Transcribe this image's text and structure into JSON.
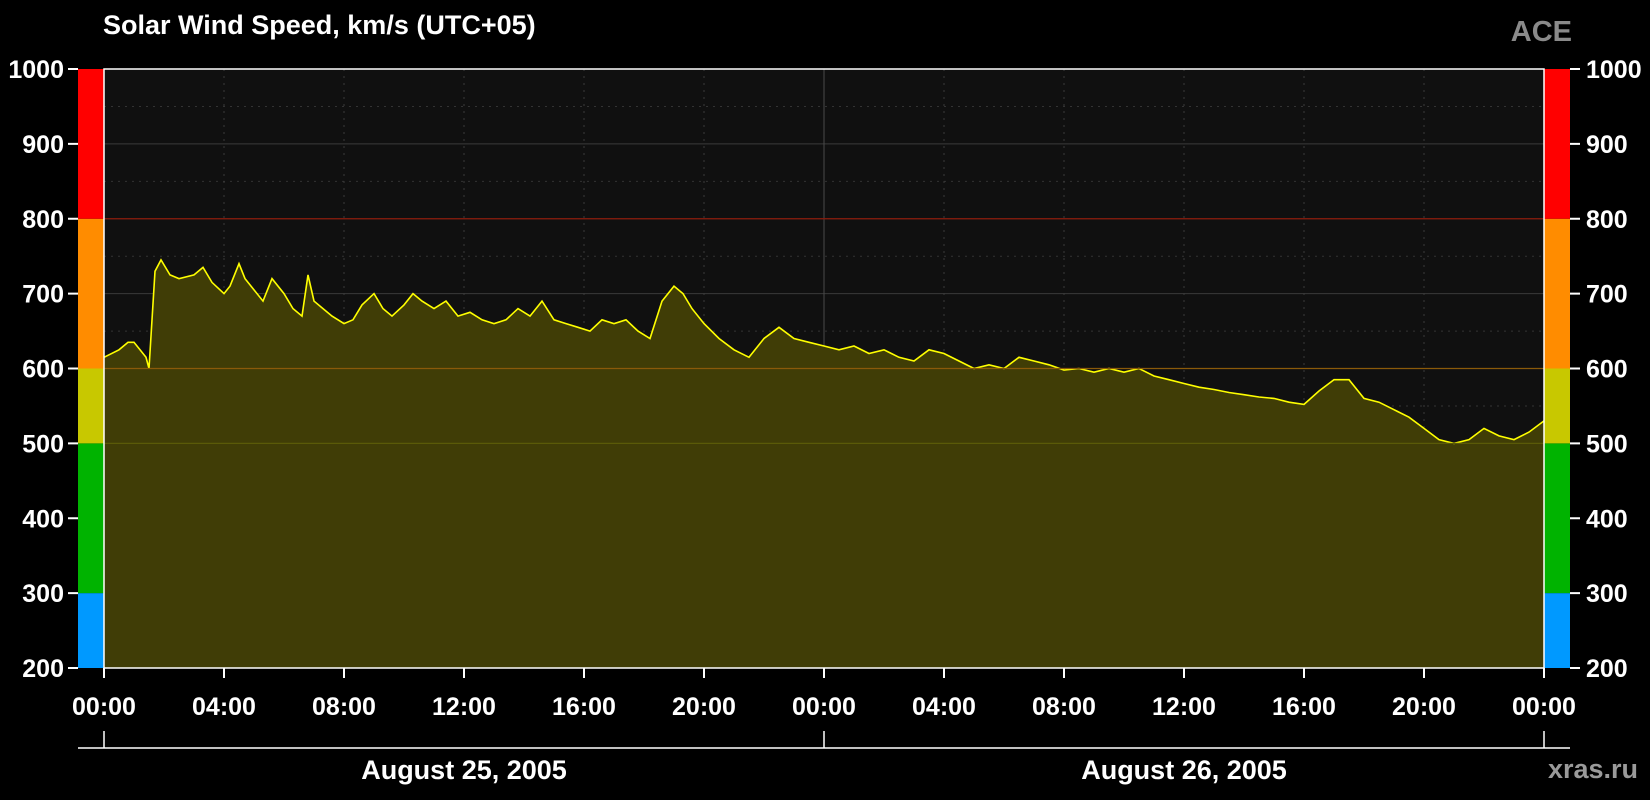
{
  "chart_data": {
    "type": "area",
    "title": "Solar Wind Speed, km/s (UTC+05)",
    "source": "ACE",
    "watermark": "xras.ru",
    "ylim": [
      200,
      1000
    ],
    "y_ticks": [
      "200",
      "300",
      "400",
      "500",
      "600",
      "700",
      "800",
      "900",
      "1000"
    ],
    "x_ticks": [
      "00:00",
      "04:00",
      "08:00",
      "12:00",
      "16:00",
      "20:00",
      "00:00",
      "04:00",
      "08:00",
      "12:00",
      "16:00",
      "20:00",
      "00:00"
    ],
    "dates": [
      "August 25, 2005",
      "August 26, 2005"
    ],
    "xlim_hours": [
      0,
      48
    ],
    "line_color": "#ffff00",
    "fill_color": "#403d06",
    "plot_background": "#101010",
    "grid": true,
    "threshold_lines": [
      {
        "value": 800,
        "color": "#8b1a0a"
      },
      {
        "value": 600,
        "color": "#8a5a0a"
      },
      {
        "value": 500,
        "color": "#5a5a08"
      }
    ],
    "speed_scale": [
      {
        "from": 200,
        "to": 300,
        "color": "#0099ff"
      },
      {
        "from": 300,
        "to": 500,
        "color": "#00b300"
      },
      {
        "from": 500,
        "to": 600,
        "color": "#c8c800"
      },
      {
        "from": 600,
        "to": 800,
        "color": "#ff8c00"
      },
      {
        "from": 800,
        "to": 1000,
        "color": "#ff0000"
      }
    ],
    "series": [
      {
        "x_hours": [
          0,
          0.5,
          0.8,
          1.0,
          1.2,
          1.4,
          1.5,
          1.7,
          1.9,
          2.2,
          2.5,
          3.0,
          3.3,
          3.6,
          4.0,
          4.2,
          4.5,
          4.7,
          5.0,
          5.3,
          5.6,
          6.0,
          6.3,
          6.6,
          6.8,
          7.0,
          7.3,
          7.6,
          8.0,
          8.3,
          8.6,
          9.0,
          9.3,
          9.6,
          10.0,
          10.3,
          10.6,
          11.0,
          11.4,
          11.8,
          12.2,
          12.6,
          13.0,
          13.4,
          13.8,
          14.2,
          14.6,
          15.0,
          15.4,
          15.8,
          16.2,
          16.6,
          17.0,
          17.4,
          17.8,
          18.2,
          18.6,
          19.0,
          19.3,
          19.6,
          20.0,
          20.5,
          21.0,
          21.5,
          22.0,
          22.5,
          23.0,
          23.5,
          24.0,
          24.5,
          25.0,
          25.5,
          26.0,
          26.5,
          27.0,
          27.5,
          28.0,
          28.5,
          29.0,
          29.5,
          30.0,
          30.5,
          31.0,
          31.5,
          32.0,
          32.5,
          33.0,
          33.5,
          34.0,
          34.5,
          35.0,
          35.5,
          36.0,
          36.5,
          37.0,
          37.5,
          38.0,
          38.5,
          39.0,
          39.5,
          40.0,
          40.5,
          41.0,
          41.5,
          42.0,
          42.5,
          43.0,
          43.5,
          44.0,
          44.5,
          45.0,
          45.5,
          46.0,
          46.5,
          47.0,
          47.5,
          48.0
        ],
        "values": [
          615,
          625,
          635,
          635,
          625,
          615,
          600,
          730,
          745,
          725,
          720,
          725,
          735,
          715,
          700,
          710,
          740,
          720,
          705,
          690,
          720,
          700,
          680,
          670,
          725,
          690,
          680,
          670,
          660,
          665,
          685,
          700,
          680,
          670,
          685,
          700,
          690,
          680,
          690,
          670,
          675,
          665,
          660,
          665,
          680,
          670,
          690,
          665,
          660,
          655,
          650,
          665,
          660,
          665,
          650,
          640,
          690,
          710,
          700,
          680,
          660,
          640,
          625,
          615,
          640,
          655,
          640,
          635,
          630,
          625,
          630,
          620,
          625,
          615,
          610,
          625,
          620,
          610,
          600,
          605,
          600,
          615,
          610,
          605,
          598,
          600,
          595,
          600,
          595,
          600,
          590,
          585,
          580,
          575,
          572,
          568,
          565,
          562,
          560,
          555,
          552,
          570,
          585,
          585,
          560,
          555,
          545,
          535,
          520,
          505,
          500,
          505,
          520,
          510,
          505,
          515,
          530
        ]
      }
    ]
  }
}
